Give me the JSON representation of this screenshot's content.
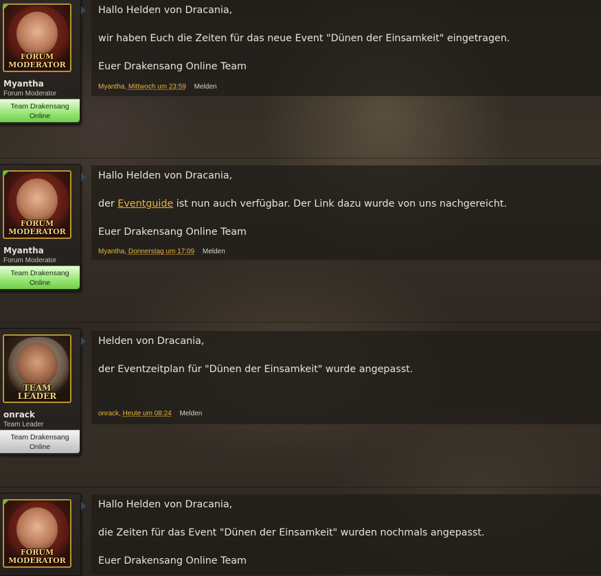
{
  "posts": [
    {
      "user": {
        "name": "Myantha",
        "title": "Forum Moderator",
        "status": "Team Drakensang Online",
        "badge_line1": "FORUM",
        "badge_line2": "MODERATOR"
      },
      "lines": [
        "Hallo Helden von Dracania,",
        "wir haben Euch die Zeiten für das neue Event \"Dünen der Einsamkeit\" eingetragen.",
        "Euer Drakensang Online Team"
      ],
      "footer": {
        "author": "Myantha,",
        "date": "Mittwoch um 23:59",
        "report": "Melden"
      }
    },
    {
      "user": {
        "name": "Myantha",
        "title": "Forum Moderator",
        "status": "Team Drakensang Online",
        "badge_line1": "FORUM",
        "badge_line2": "MODERATOR"
      },
      "line1": "Hallo Helden von Dracania,",
      "line2_before": "der ",
      "link": "Eventguide",
      "line2_after": " ist nun auch verfügbar. Der Link dazu wurde von uns nachgereicht.",
      "line3": "Euer Drakensang Online Team",
      "footer": {
        "author": "Myantha,",
        "date": "Donnerstag um 17:09",
        "report": "Melden"
      }
    },
    {
      "user": {
        "name": "onrack",
        "title": "Team Leader",
        "status": "Team Drakensang Online",
        "badge_line1": "TEAM",
        "badge_line2": "LEADER"
      },
      "lines": [
        "Helden von Dracania,",
        "der Eventzeitplan für \"Dünen der Einsamkeit\" wurde angepasst."
      ],
      "footer": {
        "author": "onrack,",
        "date": "Heute um 08:24",
        "report": "Melden"
      }
    },
    {
      "user": {
        "badge_line1": "FORUM",
        "badge_line2": "MODERATOR"
      },
      "lines": [
        "Hallo Helden von Dracania,",
        "die Zeiten für das Event \"Dünen der Einsamkeit\" wurden nochmals angepasst.",
        "Euer Drakensang Online Team"
      ]
    }
  ]
}
